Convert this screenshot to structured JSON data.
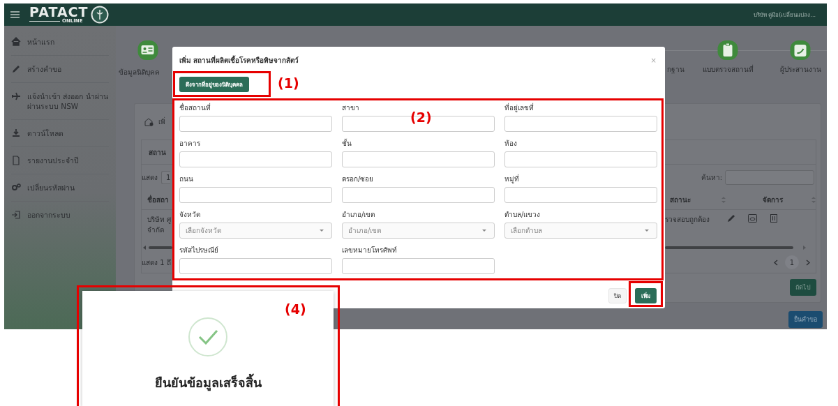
{
  "header": {
    "logo_title": "PATACT",
    "logo_subtitle": "ONLINE",
    "user_name": "บริษัท คู่มือ(เปลี่ยนแปลง..."
  },
  "sidebar": {
    "items": [
      {
        "label": "หน้าแรก"
      },
      {
        "label": "สร้างคำขอ"
      },
      {
        "label": "แจ้งนำเข้า ส่งออก นำผ่าน ผ่านระบบ NSW"
      },
      {
        "label": "ดาวน์โหลด"
      },
      {
        "label": "รายงานประจำปี"
      },
      {
        "label": "เปลี่ยนรหัสผ่าน"
      },
      {
        "label": "ออกจากระบบ"
      }
    ]
  },
  "stepper": {
    "steps": [
      {
        "label": "ข้อมูลนิติบุคค"
      },
      {
        "label": "กฐาน"
      },
      {
        "label": "แบบตรวจสถานที่"
      },
      {
        "label": "ผู้ประสานงาน"
      }
    ]
  },
  "card": {
    "title": "เพิ่",
    "tab": "สถาน",
    "show_label": "แสดง",
    "page_size": "1",
    "search_label": "ค้นหา:",
    "columns": [
      {
        "label": "ชื่อสถา"
      },
      {
        "label": "สถานะ"
      },
      {
        "label": "จัดการ"
      }
    ],
    "row": {
      "name_lines": [
        "บริษัท ศู",
        "จำกัด"
      ],
      "status": "รวจสอบถูกต้อง"
    },
    "info": "แสดง 1 ถึ",
    "page": "1",
    "next_button": "ถัดไป"
  },
  "submit_button": "ยื่นคำขอ",
  "modal": {
    "title": "เพิ่ม สถานที่ผลิตเชื้อโรคหรือพิษจากสัตว์",
    "close": "×",
    "fetch_button": "ดึงจากที่อยู่ของนิติบุคคล",
    "fields": [
      {
        "label": "ชื่อสถานที่",
        "kind": "text"
      },
      {
        "label": "สาขา",
        "kind": "text"
      },
      {
        "label": "ที่อยู่เลขที่",
        "kind": "text"
      },
      {
        "label": "อาคาร",
        "kind": "text"
      },
      {
        "label": "ชั้น",
        "kind": "text"
      },
      {
        "label": "ห้อง",
        "kind": "text"
      },
      {
        "label": "ถนน",
        "kind": "text"
      },
      {
        "label": "ตรอก/ซอย",
        "kind": "text"
      },
      {
        "label": "หมู่ที่",
        "kind": "text"
      },
      {
        "label": "จังหวัด",
        "kind": "select",
        "placeholder": "เลือกจังหวัด"
      },
      {
        "label": "อำเภอ/เขต",
        "kind": "select",
        "placeholder": "อำเภอ/เขต"
      },
      {
        "label": "ตำบล/แขวง",
        "kind": "select",
        "placeholder": "เลือกตำบล"
      },
      {
        "label": "รหัสไปรษณีย์",
        "kind": "text"
      },
      {
        "label": "เลขหมายโทรศัพท์",
        "kind": "text"
      }
    ],
    "cancel_button": "ปิด",
    "add_button": "เพิ่ม"
  },
  "toast": {
    "message": "ยืนยันข้อมูลเสร็จสิ้น"
  },
  "annotations": [
    {
      "kind": "labeled",
      "label": "(1)"
    },
    {
      "kind": "labeled",
      "label": "(2)"
    },
    {
      "kind": "frame"
    },
    {
      "kind": "labeled",
      "label": "(4)"
    }
  ]
}
